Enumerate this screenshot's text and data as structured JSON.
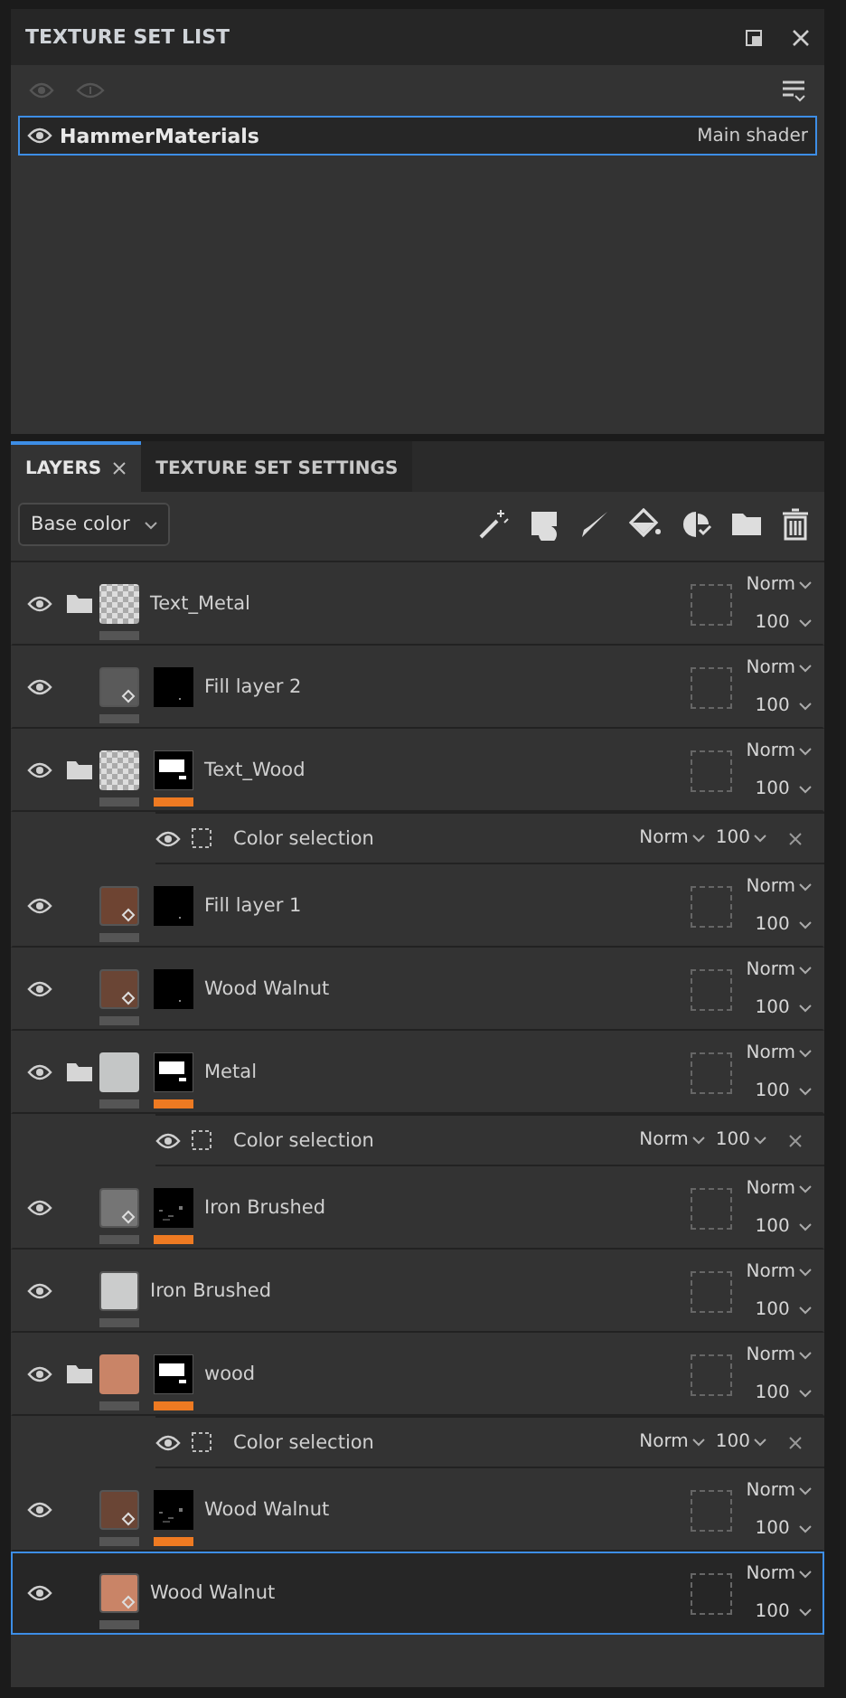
{
  "texture_set_list": {
    "title": "TEXTURE SET LIST",
    "sets": [
      {
        "name": "HammerMaterials",
        "shader": "Main shader",
        "selected": true
      }
    ]
  },
  "tabs": [
    {
      "label": "LAYERS",
      "selected": true,
      "closable": true
    },
    {
      "label": "TEXTURE SET SETTINGS",
      "selected": false,
      "closable": false
    }
  ],
  "channel": {
    "value": "Base color"
  },
  "layers": [
    {
      "kind": "folder",
      "name": "Text_Metal",
      "thumb": {
        "kind": "checker"
      },
      "blend": "Norm",
      "opacity": "100",
      "selected": false
    },
    {
      "kind": "fill",
      "name": "Fill layer 2",
      "thumb": {
        "kind": "solid",
        "color": "#5a5a5a"
      },
      "mask": {
        "kind": "dark",
        "active": false
      },
      "blend": "Norm",
      "opacity": "100",
      "selected": false
    },
    {
      "kind": "folder",
      "name": "Text_Wood",
      "thumb": {
        "kind": "checker"
      },
      "mask": {
        "kind": "shape",
        "active": true
      },
      "blend": "Norm",
      "opacity": "100",
      "selected": false,
      "filters": [
        {
          "name": "Color selection",
          "blend": "Norm",
          "opacity": "100"
        }
      ]
    },
    {
      "kind": "fill",
      "name": "Fill layer 1",
      "thumb": {
        "kind": "solid",
        "color": "#6e4432"
      },
      "mask": {
        "kind": "dark",
        "active": false
      },
      "blend": "Norm",
      "opacity": "100",
      "selected": false
    },
    {
      "kind": "fill",
      "name": "Wood Walnut",
      "thumb": {
        "kind": "solid",
        "color": "#6a4535"
      },
      "mask": {
        "kind": "dark",
        "active": false
      },
      "blend": "Norm",
      "opacity": "100",
      "selected": false
    },
    {
      "kind": "folder",
      "name": "Metal",
      "thumb": {
        "kind": "solid",
        "color": "#c4c6c6"
      },
      "mask": {
        "kind": "shape",
        "active": true
      },
      "blend": "Norm",
      "opacity": "100",
      "selected": false,
      "filters": [
        {
          "name": "Color selection",
          "blend": "Norm",
          "opacity": "100"
        }
      ]
    },
    {
      "kind": "fill",
      "name": "Iron Brushed",
      "thumb": {
        "kind": "solid",
        "color": "#757575"
      },
      "mask": {
        "kind": "noise",
        "active": true
      },
      "blend": "Norm",
      "opacity": "100",
      "selected": false
    },
    {
      "kind": "plain",
      "name": "Iron Brushed",
      "thumb": {
        "kind": "solid",
        "color": "#cbcccc"
      },
      "blend": "Norm",
      "opacity": "100",
      "selected": false
    },
    {
      "kind": "folder",
      "name": "wood",
      "thumb": {
        "kind": "solid",
        "color": "#c98467"
      },
      "mask": {
        "kind": "shape",
        "active": true
      },
      "blend": "Norm",
      "opacity": "100",
      "selected": false,
      "filters": [
        {
          "name": "Color selection",
          "blend": "Norm",
          "opacity": "100"
        }
      ]
    },
    {
      "kind": "fill",
      "name": "Wood Walnut",
      "thumb": {
        "kind": "solid",
        "color": "#6a4535"
      },
      "mask": {
        "kind": "noise",
        "active": true
      },
      "blend": "Norm",
      "opacity": "100",
      "selected": false
    },
    {
      "kind": "fill",
      "name": "Wood Walnut",
      "thumb": {
        "kind": "solid",
        "color": "#c98467"
      },
      "blend": "Norm",
      "opacity": "100",
      "selected": true
    }
  ]
}
